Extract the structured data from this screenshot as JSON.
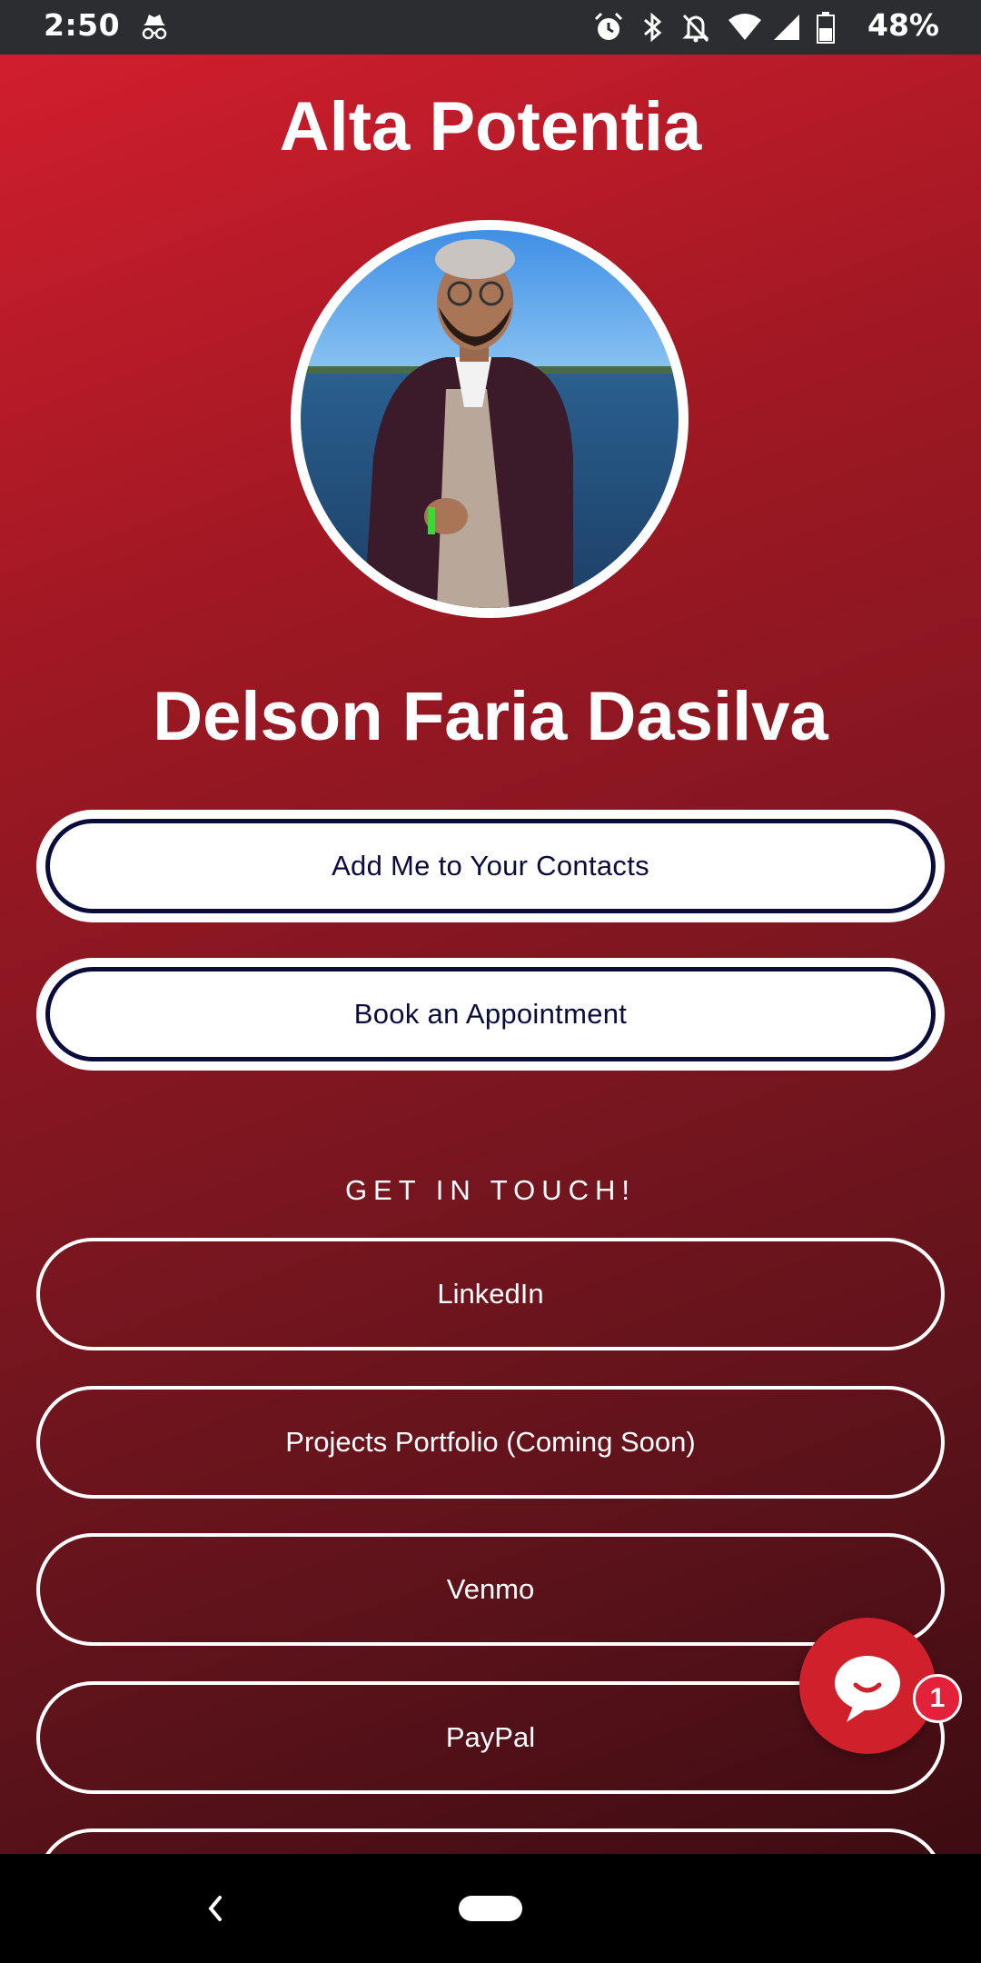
{
  "status_bar": {
    "time": "2:50",
    "battery": "48%",
    "icons": [
      "incognito-icon",
      "alarm-icon",
      "bluetooth-icon",
      "notifications-off-icon",
      "wifi-icon",
      "cellular-icon",
      "battery-icon"
    ]
  },
  "header": {
    "title": "Alta Potentia"
  },
  "profile": {
    "name": "Delson Faria Dasilva"
  },
  "actions": {
    "add_contact": "Add Me to Your Contacts",
    "book_appointment": "Book an Appointment"
  },
  "contact_section": {
    "heading": "GET IN TOUCH!",
    "links": [
      {
        "label": "LinkedIn"
      },
      {
        "label": "Projects Portfolio (Coming Soon)"
      },
      {
        "label": "Venmo"
      },
      {
        "label": "PayPal"
      }
    ]
  },
  "chat": {
    "badge_count": "1"
  },
  "colors": {
    "gradient_start": "#d11e2e",
    "gradient_end": "#3d0c12",
    "button_text": "#0b0c3c",
    "chat_bg": "#d0202c"
  }
}
